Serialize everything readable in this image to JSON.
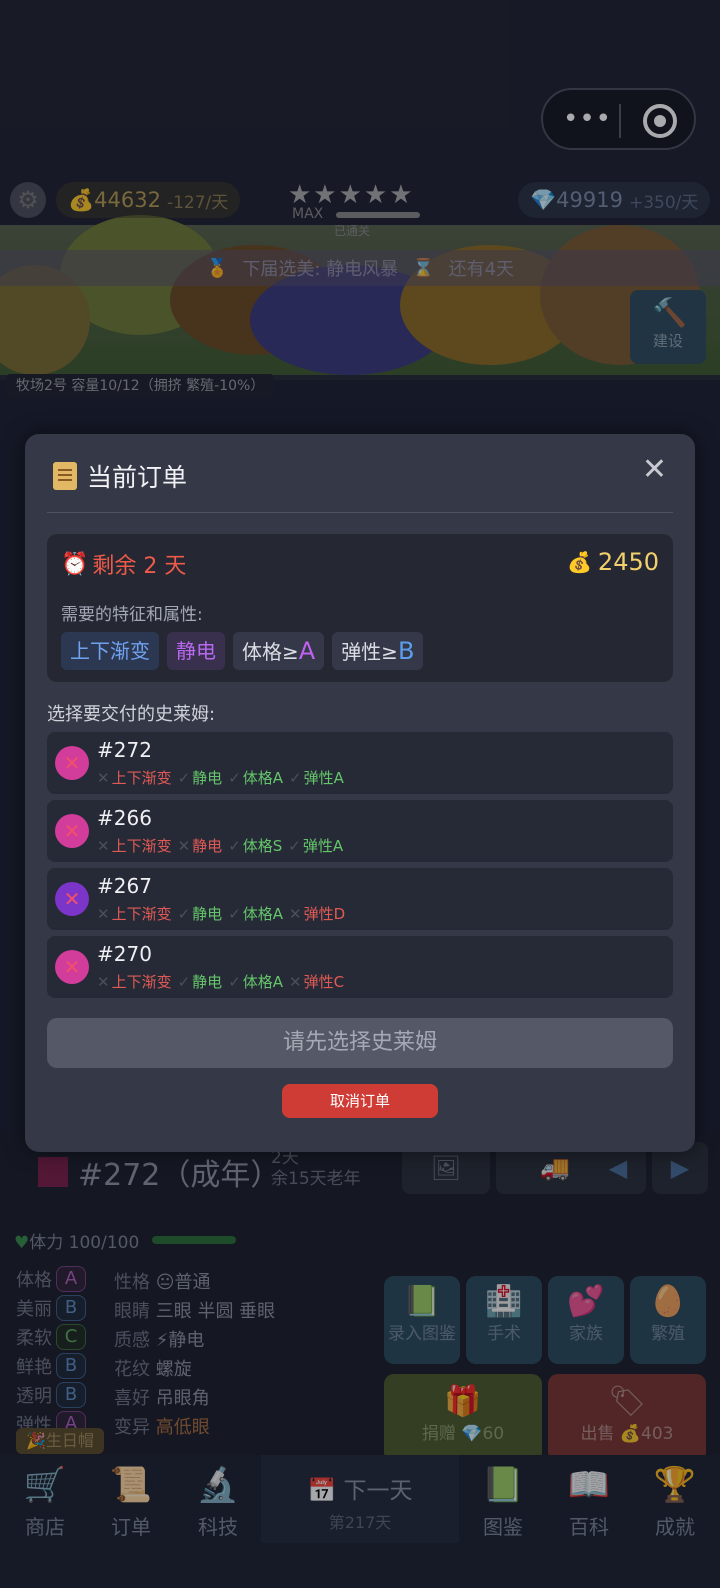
{
  "header": {
    "gold": "44632",
    "gold_rate": "-127/天",
    "stars": "★★★★★",
    "max_label": "MAX",
    "passed_label": "已通关",
    "gems": "49919",
    "gems_rate": "+350/天",
    "banner_left": "下届选美: 静电风暴",
    "banner_right": "还有4天",
    "build_label": "建设",
    "ranch_tag": "牧场2号  容量10/12（拥挤 繁殖-10%）"
  },
  "modal": {
    "title": "当前订单",
    "close_icon": "✕",
    "remaining": "剩余 2 天",
    "reward": "2450",
    "need_label": "需要的特征和属性:",
    "requirements": [
      {
        "text": "上下渐变"
      },
      {
        "text": "静电"
      },
      {
        "prefix": "体格≥",
        "grade": "A"
      },
      {
        "prefix": "弹性≥",
        "grade": "B"
      }
    ],
    "select_label": "选择要交付的史莱姆:",
    "slimes": [
      {
        "id": "#272",
        "color": "#d23c9a",
        "traits": [
          "上下渐变",
          "静电",
          "体格A",
          "弹性A"
        ]
      },
      {
        "id": "#266",
        "color": "#d23c9a",
        "traits": [
          "上下渐变",
          "静电",
          "体格S",
          "弹性A"
        ]
      },
      {
        "id": "#267",
        "color": "#7c35c9",
        "traits": [
          "上下渐变",
          "静电",
          "体格A",
          "弹性D"
        ]
      },
      {
        "id": "#270",
        "color": "#d23c9a",
        "traits": [
          "上下渐变",
          "静电",
          "体格A",
          "弹性C"
        ]
      }
    ],
    "confirm_label": "请先选择史莱姆",
    "cancel_label": "取消订单"
  },
  "detail": {
    "name": "#272（成年）",
    "age_line1": "2天",
    "age_line2": "余15天老年",
    "hp": "体力 100/100",
    "attrs": [
      {
        "label": "体格",
        "grade": "A"
      },
      {
        "label": "美丽",
        "grade": "B"
      },
      {
        "label": "柔软",
        "grade": "C"
      },
      {
        "label": "鲜艳",
        "grade": "B"
      },
      {
        "label": "透明",
        "grade": "B"
      },
      {
        "label": "弹性",
        "grade": "A"
      }
    ],
    "traits": [
      {
        "label": "性格",
        "value": "😐普通"
      },
      {
        "label": "眼睛",
        "value": "三眼 半圆 垂眼"
      },
      {
        "label": "质感",
        "value": "⚡静电"
      },
      {
        "label": "花纹",
        "value": "螺旋"
      },
      {
        "label": "喜好",
        "value": "吊眼角"
      },
      {
        "label": "变异",
        "value": "高低眼"
      }
    ],
    "birthday": "🎉生日帽",
    "actions": {
      "record": "录入图鉴",
      "surgery": "手术",
      "family": "家族",
      "breed": "繁殖",
      "donate": "捐赠 💎60",
      "sell": "出售 💰403"
    }
  },
  "tabs": {
    "shop": "商店",
    "orders": "订单",
    "tech": "科技",
    "next_day": "下一天",
    "day": "第217天",
    "catalog": "图鉴",
    "wiki": "百科",
    "achievements": "成就"
  },
  "colors": {
    "remain": "#ef5a4a",
    "reward": "#f2d06b",
    "cancel": "#cf3b35",
    "good_trait": "#64c56a",
    "bad_trait": "#e05a55"
  }
}
